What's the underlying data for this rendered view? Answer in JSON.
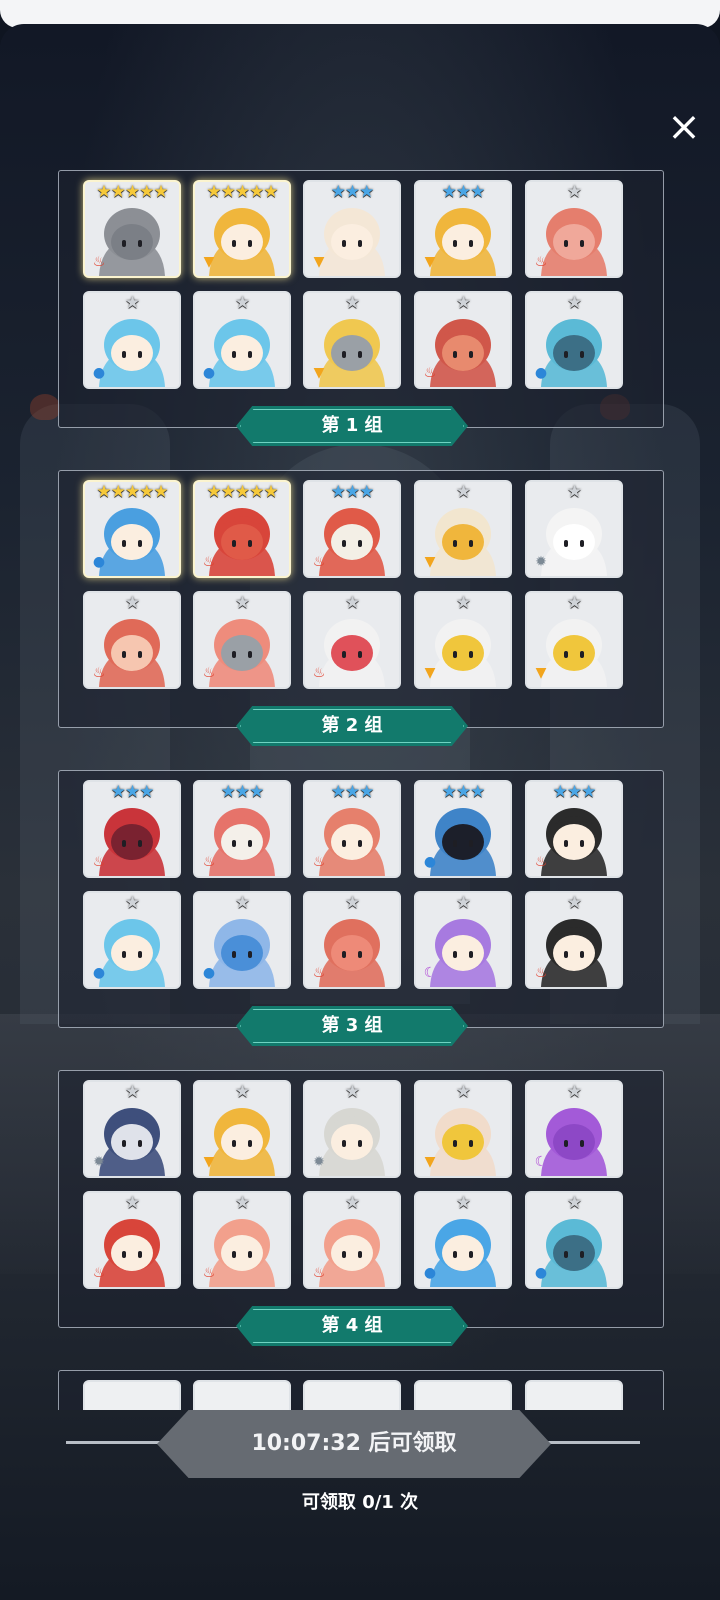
{
  "close_icon": "×",
  "groups": [
    {
      "label": "第 1 组",
      "cards": [
        {
          "stars": "★★★★★",
          "rarity": "s5",
          "gold": true,
          "element": "fire",
          "element_icon": "fire-icon",
          "hair": "#8c8f95",
          "skin": "#7b7f86"
        },
        {
          "stars": "★★★★★",
          "rarity": "s5",
          "gold": true,
          "element": "wind",
          "element_icon": "wind-icon",
          "hair": "#f0b63c",
          "skin": "#fbeee0"
        },
        {
          "stars": "★★★",
          "rarity": "s3",
          "gold": false,
          "element": "wind",
          "element_icon": "wind-icon",
          "hair": "#f4e7d6",
          "skin": "#fbeee0"
        },
        {
          "stars": "★★★",
          "rarity": "s3",
          "gold": false,
          "element": "wind",
          "element_icon": "wind-icon",
          "hair": "#f0b63c",
          "skin": "#fbeee0"
        },
        {
          "stars": "★",
          "rarity": "s1",
          "gold": false,
          "element": "fire",
          "element_icon": "fire-icon",
          "hair": "#e57e6d",
          "skin": "#f0a89a"
        },
        {
          "stars": "★",
          "rarity": "s1",
          "gold": false,
          "element": "water",
          "element_icon": "water-icon",
          "hair": "#6cc6ea",
          "skin": "#fbeee0"
        },
        {
          "stars": "★",
          "rarity": "s1",
          "gold": false,
          "element": "water",
          "element_icon": "water-icon",
          "hair": "#6cc6ea",
          "skin": "#fbeee0"
        },
        {
          "stars": "★",
          "rarity": "s1",
          "gold": false,
          "element": "wind",
          "element_icon": "wind-icon",
          "hair": "#f0c850",
          "skin": "#9aa0a6"
        },
        {
          "stars": "★",
          "rarity": "s1",
          "gold": false,
          "element": "fire",
          "element_icon": "fire-icon",
          "hair": "#d0574a",
          "skin": "#e88a6e"
        },
        {
          "stars": "★",
          "rarity": "s1",
          "gold": false,
          "element": "water",
          "element_icon": "water-icon",
          "hair": "#5bbad6",
          "skin": "#3c6f86"
        }
      ]
    },
    {
      "label": "第 2 组",
      "cards": [
        {
          "stars": "★★★★★",
          "rarity": "s5",
          "gold": true,
          "element": "water",
          "element_icon": "water-icon",
          "hair": "#4a9fe0",
          "skin": "#fbeee0"
        },
        {
          "stars": "★★★★★",
          "rarity": "s5",
          "gold": true,
          "element": "fire",
          "element_icon": "fire-icon",
          "hair": "#d8453a",
          "skin": "#e05a48"
        },
        {
          "stars": "★★★",
          "rarity": "s3",
          "gold": false,
          "element": "fire",
          "element_icon": "fire-icon",
          "hair": "#e05a48",
          "skin": "#f3efe6"
        },
        {
          "stars": "★",
          "rarity": "s1",
          "gold": false,
          "element": "wind",
          "element_icon": "wind-icon",
          "hair": "#f2e6cf",
          "skin": "#f0b63c"
        },
        {
          "stars": "★",
          "rarity": "s1",
          "gold": false,
          "element": "light",
          "element_icon": "light-icon",
          "hair": "#f4f4f4",
          "skin": "#ffffff"
        },
        {
          "stars": "★",
          "rarity": "s1",
          "gold": false,
          "element": "fire",
          "element_icon": "fire-icon",
          "hair": "#e06a58",
          "skin": "#f6c6b0"
        },
        {
          "stars": "★",
          "rarity": "s1",
          "gold": false,
          "element": "fire",
          "element_icon": "fire-icon",
          "hair": "#ee8c7c",
          "skin": "#9aa0a6"
        },
        {
          "stars": "★",
          "rarity": "s1",
          "gold": false,
          "element": "fire",
          "element_icon": "fire-icon",
          "hair": "#f2f2f2",
          "skin": "#e0515a"
        },
        {
          "stars": "★",
          "rarity": "s1",
          "gold": false,
          "element": "wind",
          "element_icon": "wind-icon",
          "hair": "#f2f2f2",
          "skin": "#f0c63c"
        },
        {
          "stars": "★",
          "rarity": "s1",
          "gold": false,
          "element": "wind",
          "element_icon": "wind-icon",
          "hair": "#f2f2f2",
          "skin": "#f0c63c"
        }
      ]
    },
    {
      "label": "第 3 组",
      "cards": [
        {
          "stars": "★★★",
          "rarity": "s3",
          "gold": false,
          "element": "fire",
          "element_icon": "fire-icon",
          "hair": "#c9343a",
          "skin": "#7a2230"
        },
        {
          "stars": "★★★",
          "rarity": "s3",
          "gold": false,
          "element": "fire",
          "element_icon": "fire-icon",
          "hair": "#e6736a",
          "skin": "#f4f0ea"
        },
        {
          "stars": "★★★",
          "rarity": "s3",
          "gold": false,
          "element": "fire",
          "element_icon": "fire-icon",
          "hair": "#e6806c",
          "skin": "#fbeee0"
        },
        {
          "stars": "★★★",
          "rarity": "s3",
          "gold": false,
          "element": "water",
          "element_icon": "water-icon",
          "hair": "#3f84c8",
          "skin": "#1c1f2a"
        },
        {
          "stars": "★★★",
          "rarity": "s3",
          "gold": false,
          "element": "fire",
          "element_icon": "fire-icon",
          "hair": "#2b2b2b",
          "skin": "#fbeee0"
        },
        {
          "stars": "★",
          "rarity": "s1",
          "gold": false,
          "element": "water",
          "element_icon": "water-icon",
          "hair": "#6cc6ea",
          "skin": "#fbeee0"
        },
        {
          "stars": "★",
          "rarity": "s1",
          "gold": false,
          "element": "water",
          "element_icon": "water-icon",
          "hair": "#8fb7e8",
          "skin": "#4a8fd8"
        },
        {
          "stars": "★",
          "rarity": "s1",
          "gold": false,
          "element": "fire",
          "element_icon": "fire-icon",
          "hair": "#e0705e",
          "skin": "#ee8a78"
        },
        {
          "stars": "★",
          "rarity": "s1",
          "gold": false,
          "element": "dark",
          "element_icon": "dark-icon",
          "hair": "#a77ae0",
          "skin": "#fbeee0"
        },
        {
          "stars": "★",
          "rarity": "s1",
          "gold": false,
          "element": "fire",
          "element_icon": "fire-icon",
          "hair": "#2b2b2b",
          "skin": "#fbeee0"
        }
      ]
    },
    {
      "label": "第 4 组",
      "cards": [
        {
          "stars": "★",
          "rarity": "s1",
          "gold": false,
          "element": "light",
          "element_icon": "light-icon",
          "hair": "#3e4f7c",
          "skin": "#dfe2ea"
        },
        {
          "stars": "★",
          "rarity": "s1",
          "gold": false,
          "element": "wind",
          "element_icon": "wind-icon",
          "hair": "#f0b63c",
          "skin": "#fbeee0"
        },
        {
          "stars": "★",
          "rarity": "s1",
          "gold": false,
          "element": "light",
          "element_icon": "light-icon",
          "hair": "#d7d7d2",
          "skin": "#fbeee0"
        },
        {
          "stars": "★",
          "rarity": "s1",
          "gold": false,
          "element": "wind",
          "element_icon": "wind-icon",
          "hair": "#f1dccb",
          "skin": "#f0c63c"
        },
        {
          "stars": "★",
          "rarity": "s1",
          "gold": false,
          "element": "dark",
          "element_icon": "dark-icon",
          "hair": "#a35ad8",
          "skin": "#8d48c6"
        },
        {
          "stars": "★",
          "rarity": "s1",
          "gold": false,
          "element": "fire",
          "element_icon": "fire-icon",
          "hair": "#d8453a",
          "skin": "#fbeee0"
        },
        {
          "stars": "★",
          "rarity": "s1",
          "gold": false,
          "element": "fire",
          "element_icon": "fire-icon",
          "hair": "#f2a08c",
          "skin": "#fbeee0"
        },
        {
          "stars": "★",
          "rarity": "s1",
          "gold": false,
          "element": "fire",
          "element_icon": "fire-icon",
          "hair": "#f2a08c",
          "skin": "#fbeee0"
        },
        {
          "stars": "★",
          "rarity": "s1",
          "gold": false,
          "element": "water",
          "element_icon": "water-icon",
          "hair": "#4aa6e6",
          "skin": "#fbeee0"
        },
        {
          "stars": "★",
          "rarity": "s1",
          "gold": false,
          "element": "water",
          "element_icon": "water-icon",
          "hair": "#5bbad6",
          "skin": "#3c6f86"
        }
      ]
    }
  ],
  "claim_button": {
    "label": "10:07:32 后可领取"
  },
  "claim_count": "可领取 0/1 次",
  "element_glyphs": {
    "fire": "♨",
    "water": "●",
    "wind": "▼",
    "light": "✹",
    "dark": "☾"
  },
  "colors": {
    "group_label_bg": "#127a6c",
    "claim_button_bg": "#666b72"
  }
}
